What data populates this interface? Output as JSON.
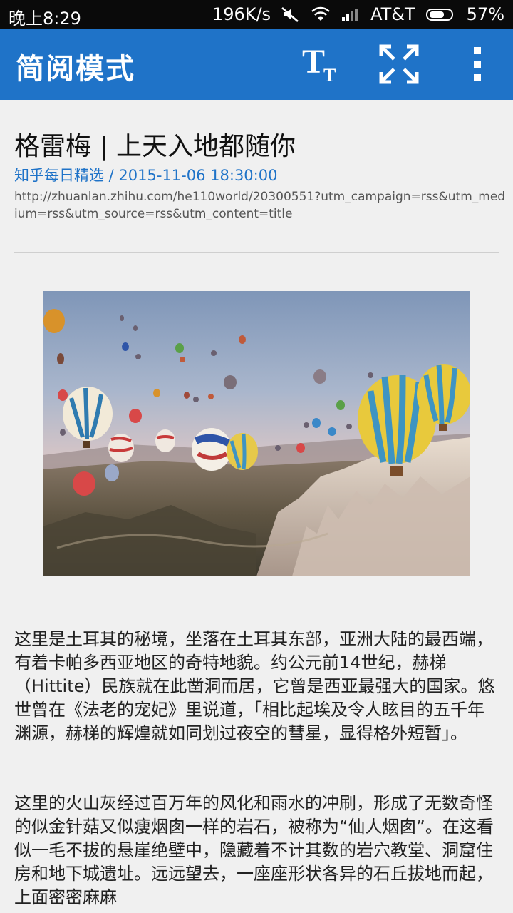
{
  "status_bar": {
    "time": "晚上8:29",
    "speed": "196K/s",
    "carrier": "AT&T",
    "battery": "57%"
  },
  "action_bar": {
    "title": "简阅模式",
    "buttons": [
      "text-size-icon",
      "fullscreen-icon",
      "more-vert-icon"
    ]
  },
  "article": {
    "title": "格雷梅 | 上天入地都随你",
    "meta": "知乎每日精选 / 2015-11-06 18:30:00",
    "url": "http://zhuanlan.zhihu.com/he110world/20300551?utm_campaign=rss&utm_medium=rss&utm_source=rss&utm_content=title",
    "paragraphs": [
      "这里是土耳其的秘境，坐落在土耳其东部，亚洲大陆的最西端，有着卡帕多西亚地区的奇特地貌。约公元前14世纪，赫梯（Hittite）民族就在此凿洞而居，它曾是西亚最强大的国家。悠世曾在《法老的宠妃》里说道，「相比起埃及令人眩目的五千年渊源，赫梯的辉煌就如同划过夜空的彗星，显得格外短暂」。",
      "这里的火山灰经过百万年的风化和雨水的冲刷，形成了无数奇怪的似金针菇又似瘦烟囱一样的岩石，被称为“仙人烟囱”。在这看似一毛不拔的悬崖绝壁中，隐藏着不计其数的岩穴教堂、洞窟住房和地下城遗址。远远望去，一座座形状各异的石丘拔地而起，上面密密麻麻"
    ]
  },
  "colors": {
    "accent": "#1f73c8",
    "status_bar": "#0a0a0a",
    "background": "#f0f0f0"
  }
}
